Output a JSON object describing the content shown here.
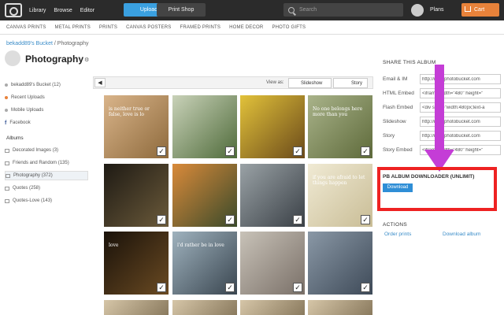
{
  "topbar": {
    "nav": [
      "Library",
      "Browse",
      "Editor"
    ],
    "upload_label": "Upload",
    "printshop_label": "Print Shop",
    "search_placeholder": "Search",
    "plans_label": "Plans",
    "cart_label": "Cart"
  },
  "categories": [
    "CANVAS PRINTS",
    "METAL PRINTS",
    "PRINTS",
    "CANVAS POSTERS",
    "FRAMED PRINTS",
    "HOME DECOR",
    "PHOTO GIFTS"
  ],
  "breadcrumb": {
    "bucket": "bekadd89's Bucket",
    "separator": " / ",
    "current": "Photography"
  },
  "page_title": "Photography",
  "sidebar": {
    "items": [
      {
        "label": "bekadd89's Bucket (12)"
      },
      {
        "label": "Recent Uploads"
      },
      {
        "label": "Mobile Uploads"
      },
      {
        "label": "Facebook"
      }
    ],
    "albums_heading": "Albums",
    "albums": [
      {
        "label": "Decorated Images (3)"
      },
      {
        "label": "Friends and Random (135)"
      },
      {
        "label": "Photography (372)",
        "selected": true
      },
      {
        "label": "Quotes (258)"
      },
      {
        "label": "Quotes-Love (143)"
      }
    ]
  },
  "viewbar": {
    "view_as": "View as:",
    "slideshow": "Slideshow",
    "story": "Story"
  },
  "thumbnails": [
    {
      "text": "is neither true or false, love is lo",
      "colors": [
        "#d9b48a",
        "#8e6a3c"
      ]
    },
    {
      "text": "",
      "colors": [
        "#c9d2b9",
        "#4f6b3a"
      ]
    },
    {
      "text": "",
      "colors": [
        "#e2c23a",
        "#6b4a1a"
      ]
    },
    {
      "text": "No one belongs here more than you",
      "colors": [
        "#a9b38a",
        "#5e6a3a"
      ]
    },
    {
      "text": "",
      "colors": [
        "#1e1a14",
        "#6b5a3a"
      ]
    },
    {
      "text": "",
      "colors": [
        "#d98a3a",
        "#3a4a2a"
      ]
    },
    {
      "text": "",
      "colors": [
        "#9aa2a6",
        "#3a4046"
      ]
    },
    {
      "text": "if you are afraid to let things happen",
      "colors": [
        "#f0ead4",
        "#c9bd96"
      ]
    },
    {
      "text": "love",
      "colors": [
        "#1a120a",
        "#6a4a22"
      ]
    },
    {
      "text": "i'd rather be in love",
      "colors": [
        "#9fb2be",
        "#3a4650"
      ]
    },
    {
      "text": "",
      "colors": [
        "#c8c2b8",
        "#7a7068"
      ]
    },
    {
      "text": "",
      "colors": [
        "#8a98a6",
        "#3e4a58"
      ]
    }
  ],
  "share": {
    "heading": "SHARE THIS ALBUM",
    "rows": [
      {
        "label": "Email & IM",
        "value": "http://i237.photobucket.com"
      },
      {
        "label": "HTML Embed",
        "value": "<iframe width=\"480\" height=\""
      },
      {
        "label": "Flash Embed",
        "value": "<div style=\"width:480px;text-a"
      },
      {
        "label": "Slideshow",
        "value": "http://i237.photobucket.com"
      },
      {
        "label": "Story",
        "value": "http://i237.photobucket.com"
      },
      {
        "label": "Story Embed",
        "value": "<iframe width=\"480\" height=\""
      }
    ]
  },
  "downloader": {
    "title": "PB ALBUM DOWNLOADER (UNLIMIT)",
    "button": "Download"
  },
  "actions": {
    "heading": "ACTIONS",
    "order": "Order prints",
    "download": "Download album"
  },
  "colors": {
    "accent": "#3aa0e0",
    "cart": "#e8823a",
    "highlight": "#ee2222",
    "arrow": "#c43dd6"
  }
}
